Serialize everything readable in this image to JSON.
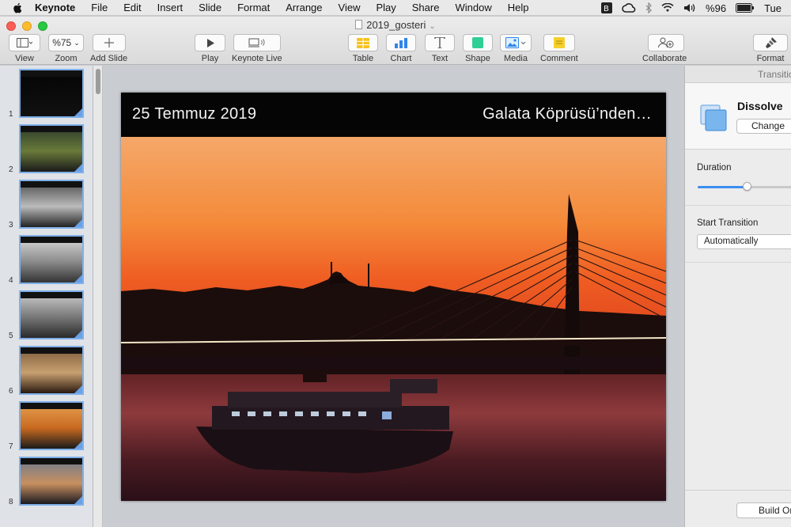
{
  "menubar": {
    "app_name": "Keynote",
    "items": [
      "File",
      "Edit",
      "Insert",
      "Slide",
      "Format",
      "Arrange",
      "View",
      "Play",
      "Share",
      "Window",
      "Help"
    ],
    "battery_text": "%96",
    "clock_text": "Tue"
  },
  "window": {
    "title": "2019_gosteri"
  },
  "toolbar": {
    "view_label": "View",
    "zoom_value": "%75",
    "zoom_label": "Zoom",
    "add_slide_label": "Add Slide",
    "play_label": "Play",
    "keynote_live_label": "Keynote Live",
    "table_label": "Table",
    "chart_label": "Chart",
    "text_label": "Text",
    "shape_label": "Shape",
    "media_label": "Media",
    "comment_label": "Comment",
    "collaborate_label": "Collaborate",
    "format_label": "Format"
  },
  "navigator": {
    "slides": [
      {
        "number": "1",
        "theme": "dark"
      },
      {
        "number": "2",
        "theme": "street"
      },
      {
        "number": "3",
        "theme": "mosque"
      },
      {
        "number": "4",
        "theme": "birds"
      },
      {
        "number": "5",
        "theme": "reflection"
      },
      {
        "number": "6",
        "theme": "arches"
      },
      {
        "number": "7",
        "theme": "sunset"
      },
      {
        "number": "8",
        "theme": "ferry"
      }
    ]
  },
  "slide": {
    "date": "25 Temmuz 2019",
    "caption": "Galata Köprüsü’nden…"
  },
  "inspector": {
    "tab_label": "Transitio",
    "effect_name": "Dissolve",
    "change_label": "Change",
    "duration_label": "Duration",
    "duration_fraction": 0.48,
    "start_transition_label": "Start Transition",
    "start_transition_value": "Automatically",
    "build_order_label": "Build Or"
  },
  "colors": {
    "accent": "#3d8ff0",
    "selection": "#7fb0ea",
    "sky_top": "#f6a35b",
    "sky_bottom": "#ef5a23"
  }
}
